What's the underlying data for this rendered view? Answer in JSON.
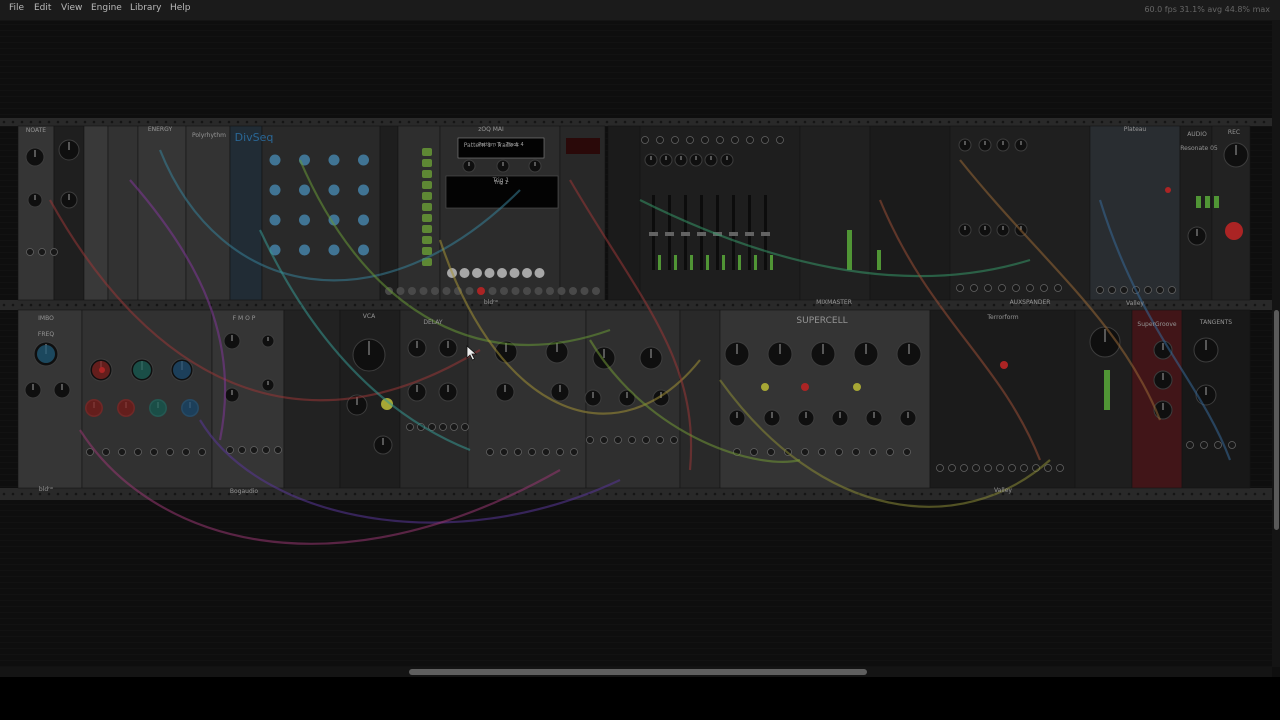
{
  "menubar": {
    "file": "File",
    "edit": "Edit",
    "view": "View",
    "engine": "Engine",
    "library": "Library",
    "help": "Help"
  },
  "status": {
    "fps": "60.0 fps  31.1% avg  44.8% max"
  },
  "rack": {
    "row1_modules": [
      {
        "label": "NOATE"
      },
      {
        "label": "ENERGY"
      },
      {
        "label": "Polyrhythm"
      },
      {
        "label": "DivSeq"
      },
      {
        "label": "zOQ MAI"
      },
      {
        "label": "Pattern 1 : Track 4"
      },
      {
        "label": "Trig 1"
      },
      {
        "label": "bldⁿᵒ"
      },
      {
        "label": "MIXMASTER"
      },
      {
        "label": "AUXSPANDER"
      },
      {
        "label": "Plateau"
      },
      {
        "label": "AUDIO"
      },
      {
        "label": "REC"
      },
      {
        "label": "Resonate 05"
      },
      {
        "label": "Valley"
      }
    ],
    "row2_modules": [
      {
        "label": "IMBO"
      },
      {
        "label": "FREQ"
      },
      {
        "label": "F M O P"
      },
      {
        "label": "DELAY"
      },
      {
        "label": "SUPERCELL"
      },
      {
        "label": "Terrorform"
      },
      {
        "label": "Valley"
      },
      {
        "label": "SuperGroove"
      },
      {
        "label": "TANGENTS"
      },
      {
        "label": "bldⁿᵒ"
      },
      {
        "label": "Bogaudio"
      },
      {
        "label": "AUDIO"
      },
      {
        "label": "VCA"
      }
    ]
  },
  "colors": {
    "menubar_bg": "#1b1b1b",
    "canvas_bg": "#141414",
    "accent_red": "#d93b3b",
    "led_green": "#8fd34a",
    "led_yellow": "#e8e84a",
    "led_blue": "#5fb4e8"
  },
  "icons": {
    "cursor": "mouse-pointer-icon"
  }
}
